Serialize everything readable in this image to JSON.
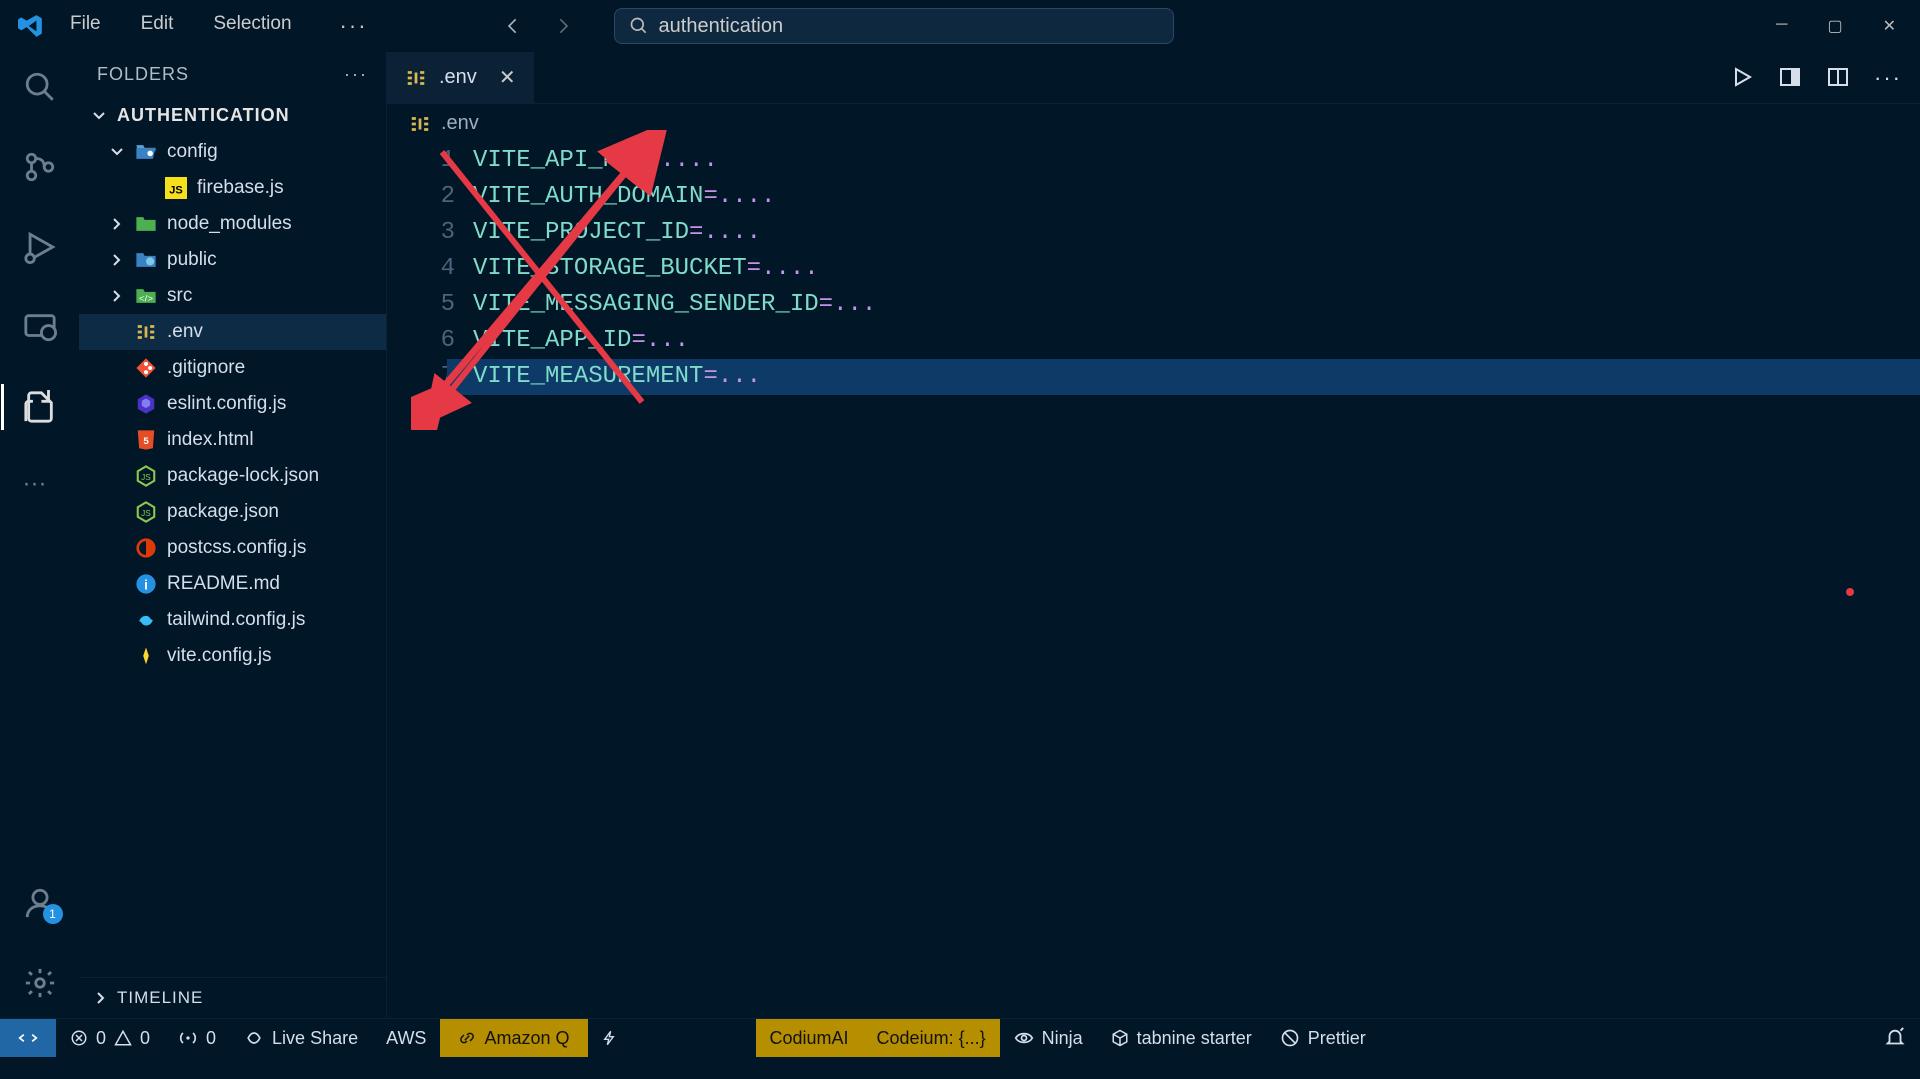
{
  "menu": {
    "file": "File",
    "edit": "Edit",
    "selection": "Selection"
  },
  "search": {
    "placeholder": "authentication"
  },
  "sidebar": {
    "header": "FOLDERS",
    "root": "AUTHENTICATION",
    "timeline": "TIMELINE",
    "items": [
      {
        "name": "config",
        "type": "folder-open",
        "depth": 1,
        "expanded": true
      },
      {
        "name": "firebase.js",
        "type": "js",
        "depth": 2
      },
      {
        "name": "node_modules",
        "type": "folder",
        "depth": 1,
        "expanded": false
      },
      {
        "name": "public",
        "type": "folder-globe",
        "depth": 1,
        "expanded": false
      },
      {
        "name": "src",
        "type": "folder-src",
        "depth": 1,
        "expanded": false
      },
      {
        "name": ".env",
        "type": "env",
        "depth": 1,
        "selected": true
      },
      {
        "name": ".gitignore",
        "type": "git",
        "depth": 1
      },
      {
        "name": "eslint.config.js",
        "type": "eslint",
        "depth": 1
      },
      {
        "name": "index.html",
        "type": "html",
        "depth": 1
      },
      {
        "name": "package-lock.json",
        "type": "node",
        "depth": 1
      },
      {
        "name": "package.json",
        "type": "node",
        "depth": 1
      },
      {
        "name": "postcss.config.js",
        "type": "postcss",
        "depth": 1
      },
      {
        "name": "README.md",
        "type": "info",
        "depth": 1
      },
      {
        "name": "tailwind.config.js",
        "type": "tailwind",
        "depth": 1
      },
      {
        "name": "vite.config.js",
        "type": "vite",
        "depth": 1
      }
    ]
  },
  "tab": {
    "title": ".env"
  },
  "breadcrumb": {
    "file": ".env"
  },
  "code": {
    "lines": [
      {
        "key": "VITE_API_KEY",
        "val": "...."
      },
      {
        "key": "VITE_AUTH_DOMAIN",
        "val": "...."
      },
      {
        "key": "VITE_PROJECT_ID",
        "val": "...."
      },
      {
        "key": "VITE_STORAGE_BUCKET",
        "val": "...."
      },
      {
        "key": "VITE_MESSAGING_SENDER_ID",
        "val": "..."
      },
      {
        "key": "VITE_APP_ID",
        "val": "..."
      },
      {
        "key": "VITE_MEASUREMENT",
        "val": "..."
      }
    ]
  },
  "status": {
    "errors": "0",
    "warnings": "0",
    "ports": "0",
    "liveshare": "Live Share",
    "aws": "AWS",
    "amazonq": "Amazon Q",
    "codium": "CodiumAI",
    "codeium": "Codeium: {...}",
    "ninja": "Ninja",
    "tabnine": "tabnine starter",
    "prettier": "Prettier"
  },
  "accounts_badge": "1"
}
